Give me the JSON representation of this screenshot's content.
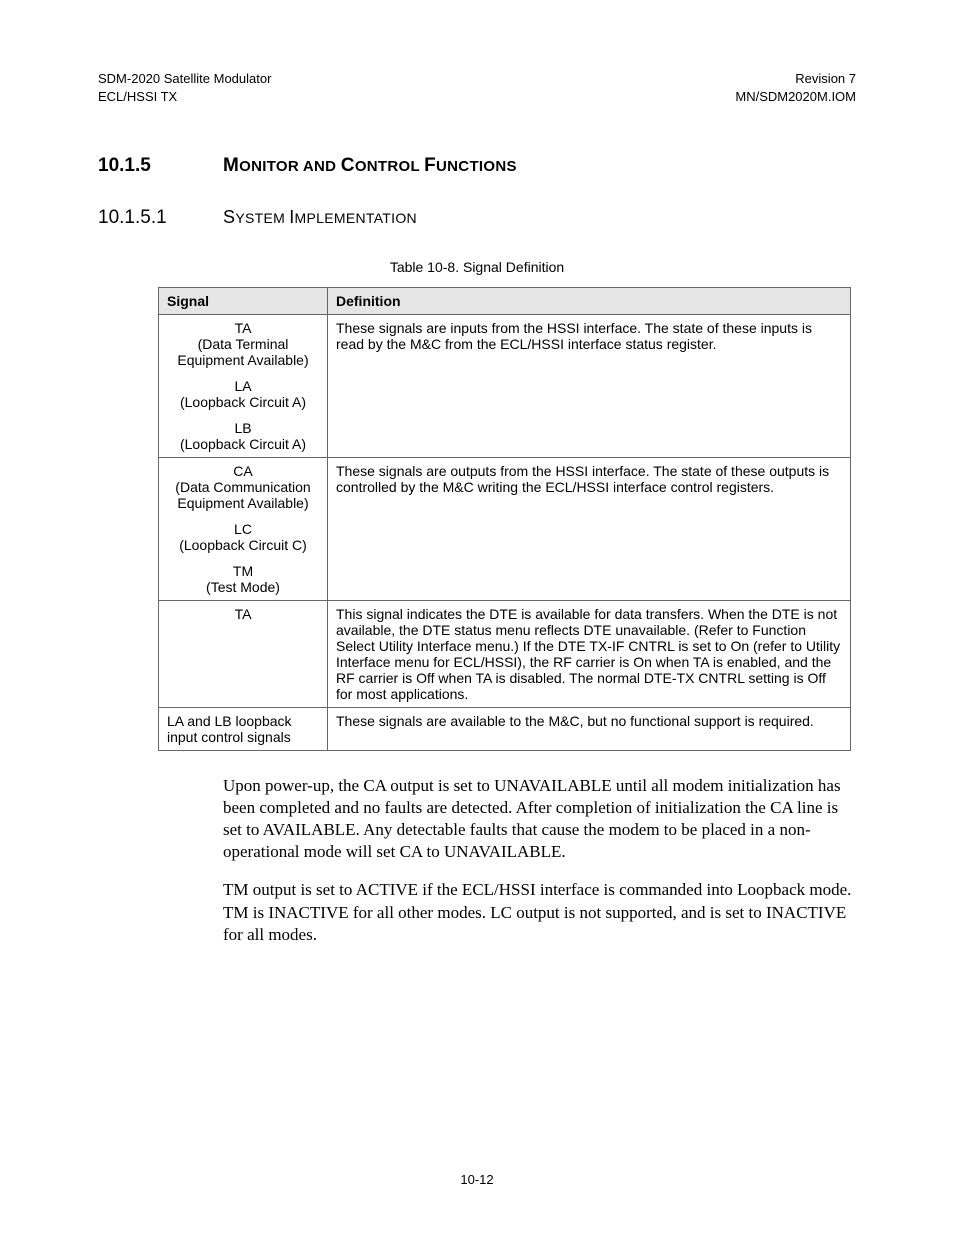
{
  "header": {
    "left_line1": "SDM-2020 Satellite Modulator",
    "left_line2": "ECL/HSSI TX",
    "right_line1": "Revision 7",
    "right_line2": "MN/SDM2020M.IOM"
  },
  "section": {
    "num": "10.1.5",
    "title_lead": "M",
    "title_sc": "ONITOR AND ",
    "title_lead2": "C",
    "title_sc2": "ONTROL ",
    "title_lead3": "F",
    "title_sc3": "UNCTIONS"
  },
  "subsection": {
    "num": "10.1.5.1",
    "title_lead": "S",
    "title_sc": "YSTEM ",
    "title_lead2": "I",
    "title_sc2": "MPLEMENTATION"
  },
  "table": {
    "caption": "Table 10-8.  Signal Definition",
    "head_signal": "Signal",
    "head_def": "Definition",
    "rows": [
      {
        "sig_blocks": [
          "TA\n(Data Terminal Equipment Available)",
          "LA\n(Loopback Circuit A)",
          "LB\n(Loopback Circuit A)"
        ],
        "def": "These signals are inputs from the HSSI interface. The state of these inputs is read by the M&C from the ECL/HSSI interface status register."
      },
      {
        "sig_blocks": [
          "CA\n(Data Communication Equipment Available)",
          "LC\n(Loopback Circuit C)",
          "TM\n(Test Mode)"
        ],
        "def": "These signals are outputs from the HSSI interface. The state of these outputs is controlled by the M&C writing the ECL/HSSI interface control registers."
      },
      {
        "sig_blocks": [
          "TA"
        ],
        "def": "This signal indicates the DTE is available for data transfers. When the DTE is not available, the DTE status menu reflects DTE unavailable. (Refer to Function Select Utility Interface menu.) If the DTE TX-IF CNTRL is set to On (refer to Utility Interface menu for ECL/HSSI), the RF carrier is On when TA is enabled, and the RF carrier is Off when TA is disabled. The normal DTE-TX CNTRL setting is Off for most applications."
      },
      {
        "sig_left": "LA and LB loopback input control signals",
        "def": "These signals are available to the M&C, but no functional support is required."
      }
    ]
  },
  "body": {
    "p1": "Upon power-up, the CA output is set to UNAVAILABLE until all modem initialization has been completed and no faults are detected. After completion of initialization the CA line is set to AVAILABLE. Any detectable faults that cause the modem to be placed in a non-operational mode will set CA to UNAVAILABLE.",
    "p2": "TM output is set to ACTIVE if the ECL/HSSI interface is commanded into Loopback mode. TM is INACTIVE for all other modes. LC output is not supported, and is set to INACTIVE for all modes."
  },
  "footer": "10-12"
}
